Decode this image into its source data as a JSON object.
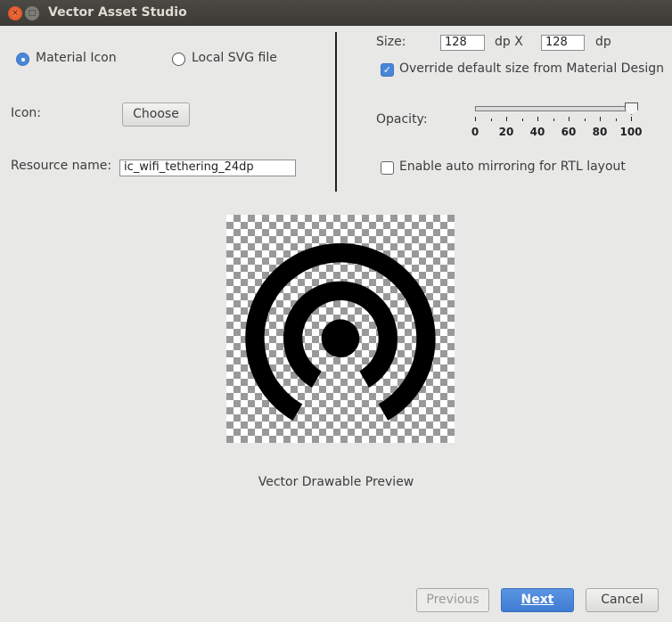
{
  "window": {
    "title": "Vector Asset Studio",
    "close_glyph": "×",
    "max_glyph": "□"
  },
  "source": {
    "material_label": "Material Icon",
    "local_label": "Local SVG file",
    "selected": "Material Icon"
  },
  "icon": {
    "label": "Icon:",
    "choose_label": "Choose"
  },
  "resource": {
    "label": "Resource name:",
    "value": "ic_wifi_tethering_24dp"
  },
  "size": {
    "label": "Size:",
    "width": "128",
    "height": "128",
    "unit": "dp",
    "x_label": "dp X"
  },
  "override": {
    "label": "Override default size from Material Design",
    "checked": true
  },
  "opacity": {
    "label": "Opacity:",
    "value": 100,
    "ticks": [
      "0",
      "20",
      "40",
      "60",
      "80",
      "100"
    ]
  },
  "mirroring": {
    "label": "Enable auto mirroring for RTL layout",
    "checked": false
  },
  "preview": {
    "caption": "Vector Drawable Preview",
    "icon": "wifi-tethering-icon"
  },
  "footer": {
    "previous": "Previous",
    "next": "Next",
    "cancel": "Cancel"
  },
  "colors": {
    "accent": "#4a86d8",
    "background": "#e8e8e7"
  }
}
